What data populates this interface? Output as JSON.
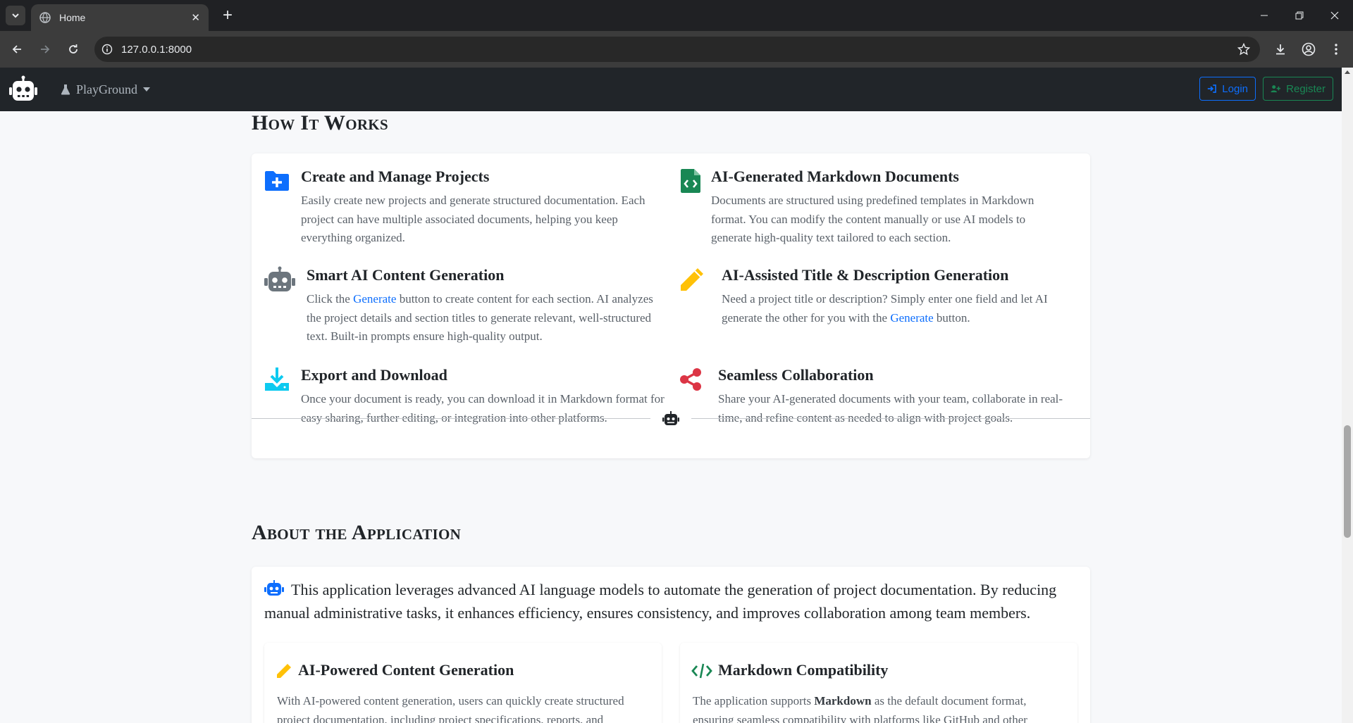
{
  "browser": {
    "tab_title": "Home",
    "tab_close": "✕",
    "new_tab": "+",
    "url": "127.0.0.1:8000"
  },
  "navbar": {
    "menu_label": "PlayGround",
    "login_label": "Login",
    "register_label": "Register"
  },
  "how_it_works": {
    "title": "How It Works",
    "features": [
      {
        "title": "Create and Manage Projects",
        "text": "Easily create new projects and generate structured documentation. Each project can have multiple associated documents, helping you keep everything organized.",
        "icon": "folder-plus-icon",
        "color": "#0d6efd"
      },
      {
        "title": "AI-Generated Markdown Documents",
        "text": "Documents are structured using predefined templates in Markdown format. You can modify the content manually or use AI models to generate high-quality text tailored to each section.",
        "icon": "file-code-icon",
        "color": "#198754"
      },
      {
        "title": "Smart AI Content Generation",
        "text_before": "Click the ",
        "link": "Generate",
        "text_after": " button to create content for each section. AI analyzes the project details and section titles to generate relevant, well-structured text. Built-in prompts ensure high-quality output.",
        "icon": "robot-icon",
        "color": "#6c757d"
      },
      {
        "title": "AI-Assisted Title & Description Generation",
        "text_before": "Need a project title or description? Simply enter one field and let AI generate the other for you with the ",
        "link": "Generate",
        "text_after": " button.",
        "icon": "pencil-icon",
        "color": "#ffc107"
      },
      {
        "title": "Export and Download",
        "text": "Once your document is ready, you can download it in Markdown format for easy sharing, further editing, or integration into other platforms.",
        "icon": "download-icon",
        "color": "#0dcaf0"
      },
      {
        "title": "Seamless Collaboration",
        "text": "Share your AI-generated documents with your team, collaborate in real-time, and refine content as needed to align with project goals.",
        "icon": "share-icon",
        "color": "#dc3545"
      }
    ]
  },
  "about": {
    "title": "About the Application",
    "intro": "This application leverages advanced AI language models to automate the generation of project documentation. By reducing manual administrative tasks, it enhances efficiency, ensures consistency, and improves collaboration among team members.",
    "cards": [
      {
        "title": "AI-Powered Content Generation",
        "text": "With AI-powered content generation, users can quickly create structured project documentation, including project specifications, reports, and",
        "icon": "pencil-icon",
        "color": "#ffc107"
      },
      {
        "title": "Markdown Compatibility",
        "text_before": "The application supports ",
        "bold": "Markdown",
        "text_after": " as the default document format, ensuring seamless compatibility with platforms like GitHub and other",
        "icon": "code-icon",
        "color": "#198754"
      }
    ]
  }
}
